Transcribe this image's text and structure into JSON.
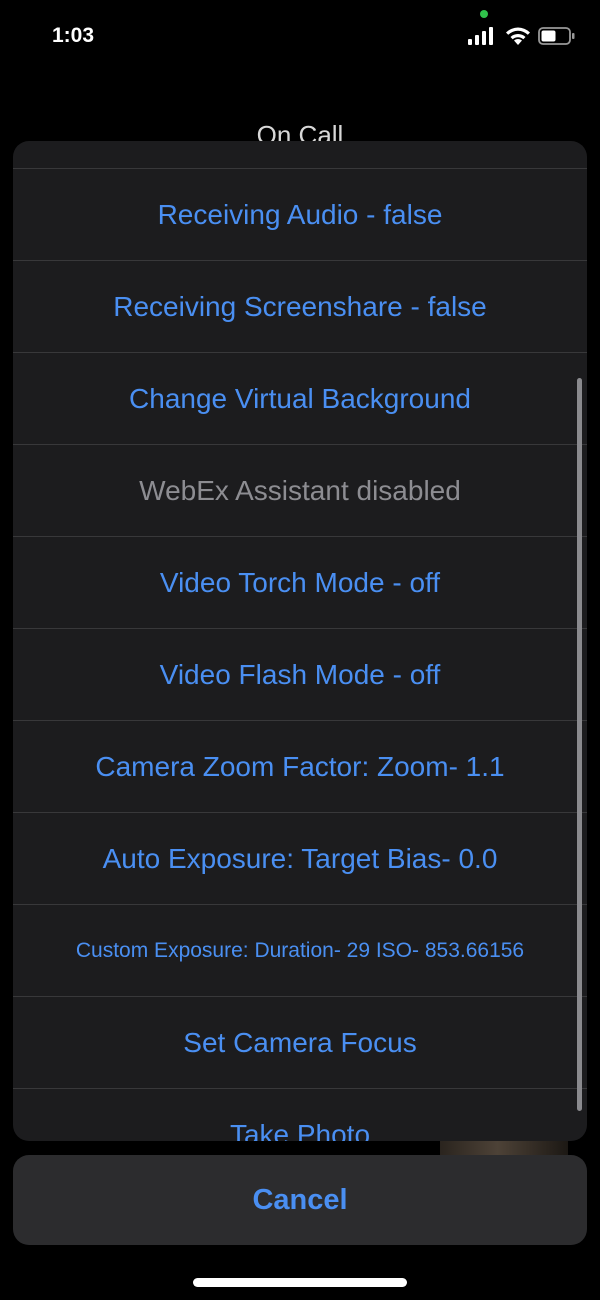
{
  "status_bar": {
    "time": "1:03"
  },
  "background": {
    "title": "On Call"
  },
  "actions": [
    {
      "label": "",
      "enabled": true
    },
    {
      "label": "Receiving Audio - false",
      "enabled": true
    },
    {
      "label": "Receiving Screenshare - false",
      "enabled": true
    },
    {
      "label": "Change Virtual Background",
      "enabled": true
    },
    {
      "label": "WebEx Assistant disabled",
      "enabled": false
    },
    {
      "label": "Video Torch Mode - off",
      "enabled": true
    },
    {
      "label": "Video Flash Mode - off",
      "enabled": true
    },
    {
      "label": "Camera Zoom Factor: Zoom- 1.1",
      "enabled": true
    },
    {
      "label": "Auto Exposure: Target Bias- 0.0",
      "enabled": true
    },
    {
      "label": "Custom Exposure: Duration- 29 ISO- 853.66156",
      "enabled": true
    },
    {
      "label": "Set Camera Focus",
      "enabled": true
    },
    {
      "label": "Take Photo",
      "enabled": true
    }
  ],
  "cancel_label": "Cancel",
  "colors": {
    "accent": "#4a8ff2",
    "disabled": "#8d8d92",
    "sheet": "#1c1c1e"
  }
}
